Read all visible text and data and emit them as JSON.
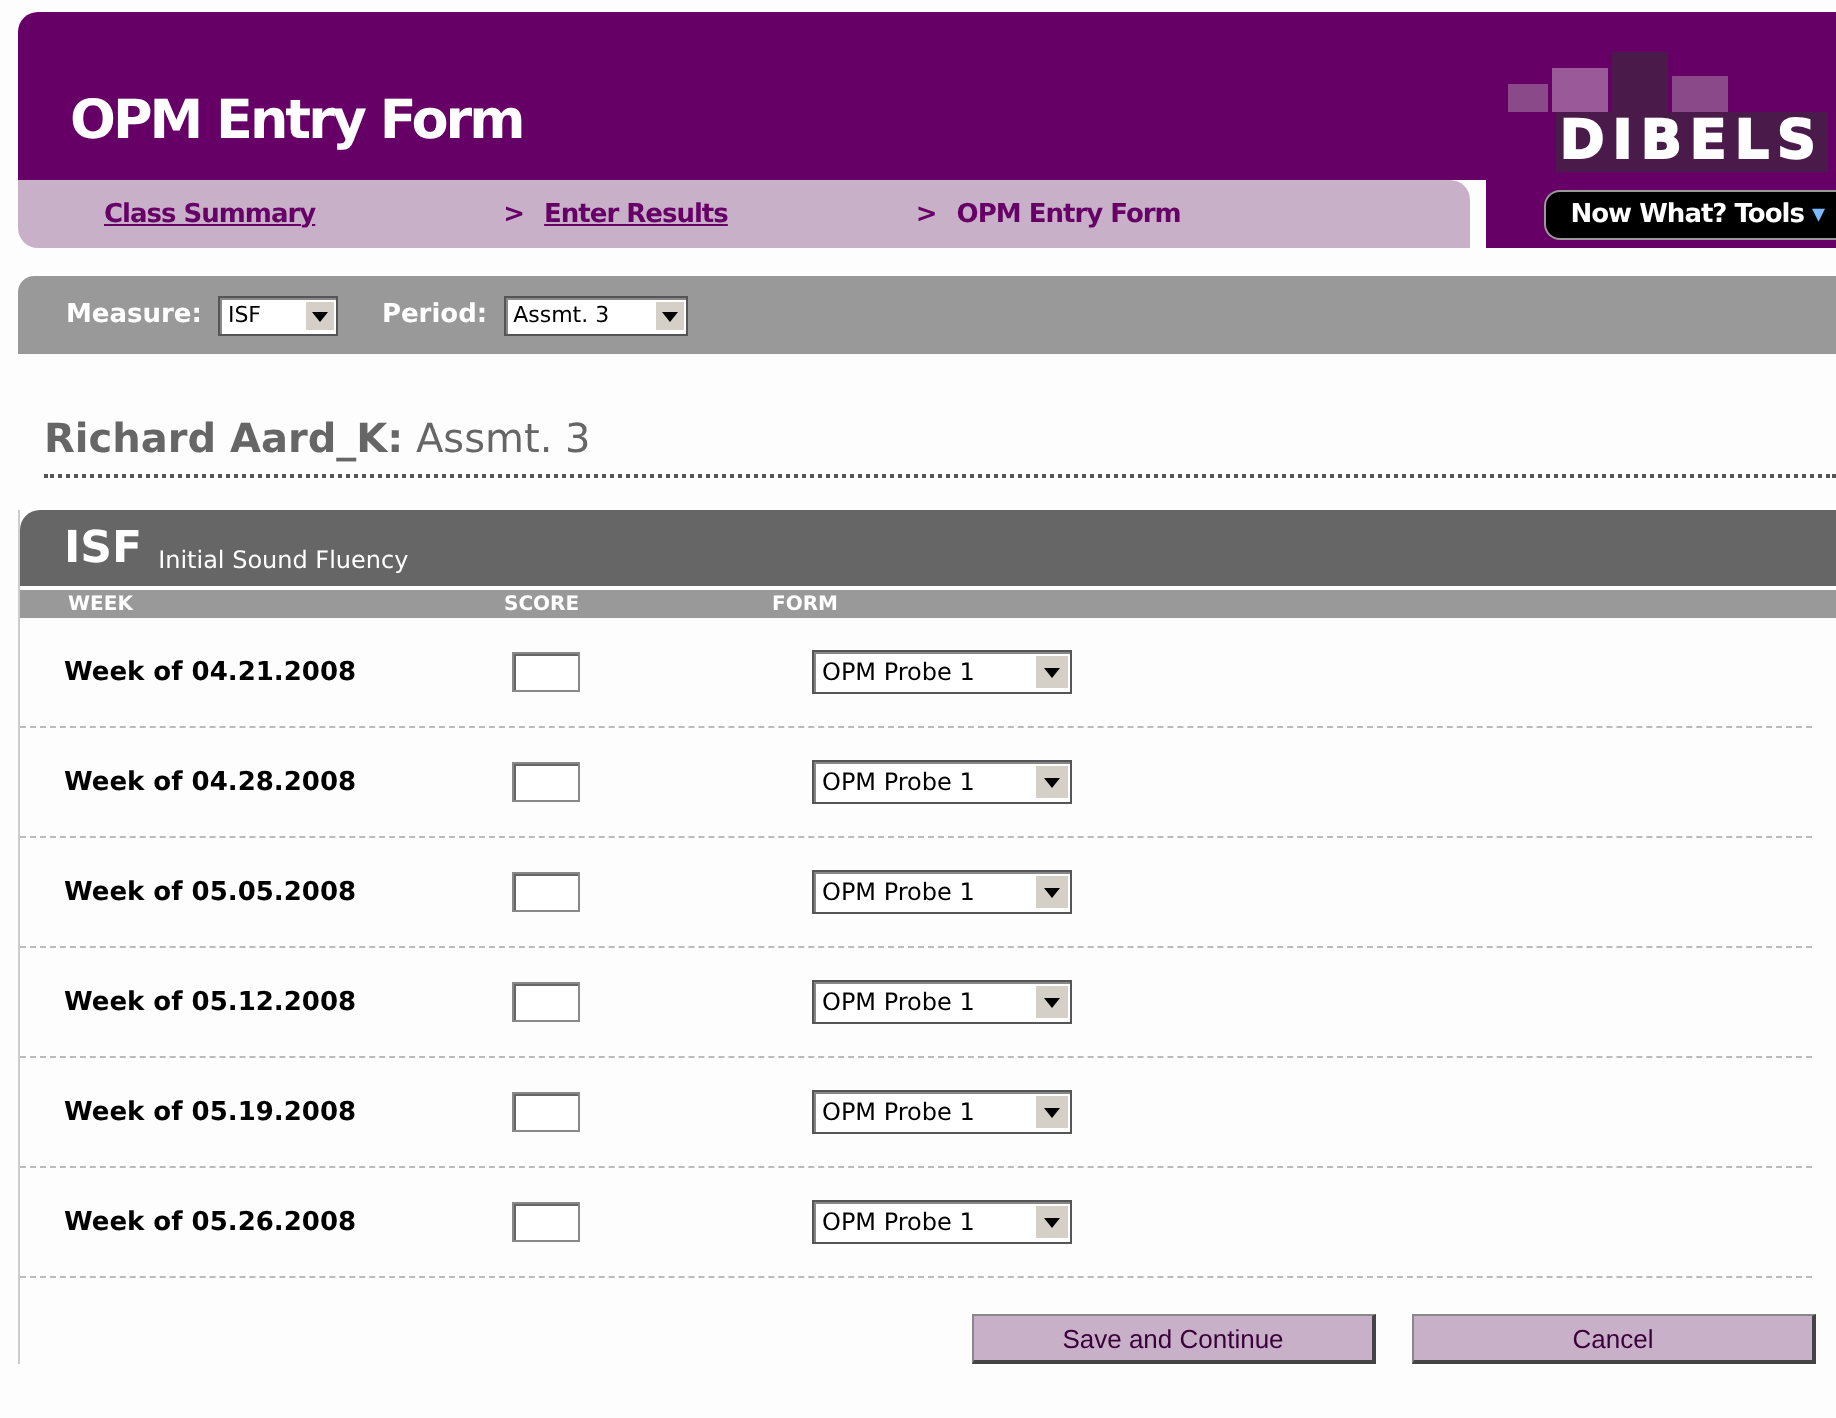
{
  "header": {
    "title": "OPM Entry Form",
    "logo": "DIBELS"
  },
  "breadcrumbs": [
    {
      "label": "Class Summary",
      "kind": "link"
    },
    {
      "label": "Enter Results",
      "kind": "link"
    },
    {
      "label": "OPM Entry Form",
      "kind": "current"
    }
  ],
  "breadcrumb_separator": ">",
  "tools_button": {
    "label": "Now What? Tools",
    "caret": "▾"
  },
  "filters": [
    {
      "label": "Measure:",
      "value": "ISF"
    },
    {
      "label": "Period:",
      "value": "Assmt. 3"
    }
  ],
  "student": {
    "name": "Richard Aard_K:",
    "period": "Assmt. 3"
  },
  "section": {
    "code": "ISF",
    "title": "Initial Sound Fluency"
  },
  "columns": [
    "WEEK",
    "SCORE",
    "FORM"
  ],
  "rows": [
    {
      "week": "Week of 04.21.2008",
      "form": "OPM Probe 1"
    },
    {
      "week": "Week of 04.28.2008",
      "form": "OPM Probe 1"
    },
    {
      "week": "Week of 05.05.2008",
      "form": "OPM Probe 1"
    },
    {
      "week": "Week of 05.12.2008",
      "form": "OPM Probe 1"
    },
    {
      "week": "Week of 05.19.2008",
      "form": "OPM Probe 1"
    },
    {
      "week": "Week of 05.26.2008",
      "form": "OPM Probe 1"
    }
  ],
  "buttons": [
    "Save and Continue",
    "Cancel"
  ]
}
